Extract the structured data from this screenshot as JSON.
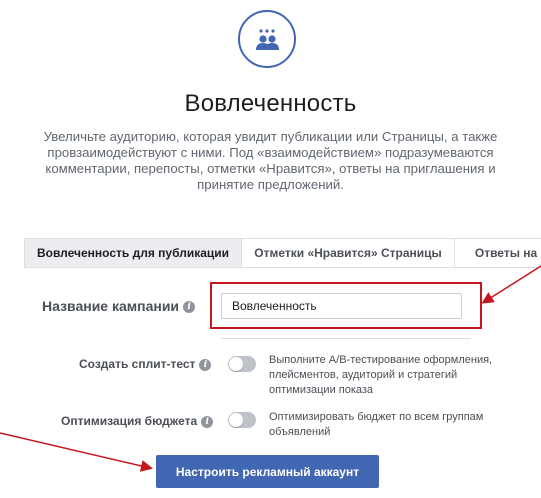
{
  "header": {
    "icon": "people-group-icon",
    "title": "Вовлеченность",
    "description": "Увеличьте аудиторию, которая увидит публикации или Страницы, а также провзаимодействуют с ними. Под «взаимодействием» подразумеваются комментарии, перепосты, отметки «Нравится», ответы на приглашения и принятие предложений."
  },
  "tabs": [
    {
      "label": "Вовлеченность для публикации",
      "active": true
    },
    {
      "label": "Отметки «Нравится» Страницы",
      "active": false
    },
    {
      "label": "Ответы на пр",
      "active": false
    }
  ],
  "campaign": {
    "label": "Название кампании",
    "value": "Вовлеченность"
  },
  "split_test": {
    "label": "Создать сплит-тест",
    "enabled": false,
    "description": "Выполните A/B-тестирование оформления, плейсментов, аудиторий и стратегий оптимизации показа"
  },
  "budget_optimization": {
    "label": "Оптимизация бюджета",
    "enabled": false,
    "description": "Оптимизировать бюджет по всем группам объявлений"
  },
  "cta": {
    "label": "Настроить рекламный аккаунт"
  },
  "colors": {
    "accent": "#4267b2",
    "highlight": "#c4161c",
    "toggle_off": "#bec3c9"
  }
}
